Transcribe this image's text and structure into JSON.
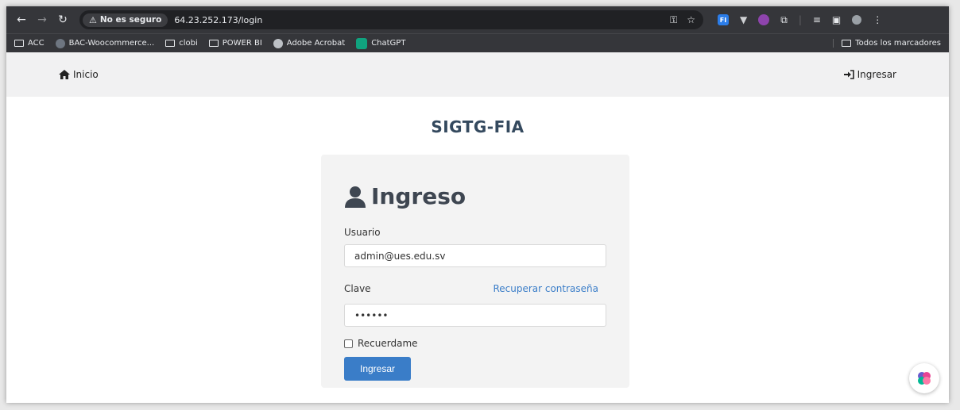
{
  "browser": {
    "security_label": "No es seguro",
    "url": "64.23.252.173/login",
    "bookmarks": [
      {
        "label": "ACC",
        "icon": "folder-icon"
      },
      {
        "label": "BAC-Woocommerce...",
        "icon": "github-icon"
      },
      {
        "label": "clobi",
        "icon": "folder-icon"
      },
      {
        "label": "POWER BI",
        "icon": "folder-icon"
      },
      {
        "label": "Adobe Acrobat",
        "icon": "globe-icon"
      },
      {
        "label": "ChatGPT",
        "icon": "chatgpt-icon"
      }
    ],
    "all_bookmarks_label": "Todos los marcadores"
  },
  "navbar": {
    "home_label": "Inicio",
    "login_label": "Ingresar"
  },
  "brand": "SIGTG-FIA",
  "login_card": {
    "title": "Ingreso",
    "user_label": "Usuario",
    "user_value": "admin@ues.edu.sv",
    "password_label": "Clave",
    "recover_link": "Recuperar contraseña",
    "password_value": "••••••",
    "remember_label": "Recuerdame",
    "submit_label": "Ingresar"
  },
  "colors": {
    "primary": "#3a7dc8",
    "brand_text": "#34495e",
    "navbar_bg": "#f1f1f2",
    "card_bg": "#f3f3f3"
  }
}
